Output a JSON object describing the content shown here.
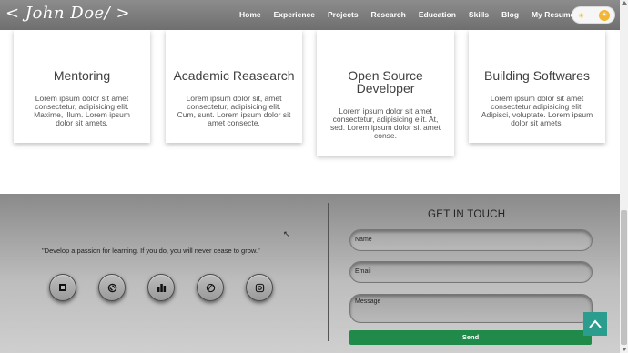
{
  "nav": {
    "logo": "< John Doe/ >",
    "links": [
      "Home",
      "Experience",
      "Projects",
      "Research",
      "Education",
      "Skills",
      "Blog",
      "My Resume"
    ],
    "toggle_icon": "sun-icon"
  },
  "cards": [
    {
      "title": "Mentoring",
      "text": "Lorem ipsum dolor sit amet consectetur, adipisicing elit. Maxime, illum. Lorem ipsum dolor sit amets."
    },
    {
      "title": "Academic Reasearch",
      "text": "Lorem ipsum dolor sit, amet consectetur, adipisicing elit. Cum, sunt. Lorem ipsum dolor sit amet consecte."
    },
    {
      "title": "Open Source Developer",
      "text": "Lorem ipsum dolor sit amet consectetur, adipisicing elit. At, sed. Lorem ipsum dolor sit amet conse."
    },
    {
      "title": "Building Softwares",
      "text": "Lorem ipsum dolor sit amet consectetur adipisicing elit. Adipisci, voluptate. Lorem ipsum dolor sit amets."
    }
  ],
  "footer": {
    "quote": "\"Develop a passion for learning. If you do, you will never cease to grow.\"",
    "social_icons": [
      "square-logo-icon",
      "gatsby-icon",
      "bar-chart-icon",
      "dribbble-icon",
      "instagram-icon"
    ],
    "contact_title": "GET IN TOUCH",
    "name_placeholder": "Name",
    "email_placeholder": "Email",
    "message_placeholder": "Message",
    "send_label": "Send"
  },
  "colors": {
    "nav_bg": "#7c7c7c",
    "send_bg": "#1f8a4a",
    "to_top_bg": "#2a9d8f"
  }
}
